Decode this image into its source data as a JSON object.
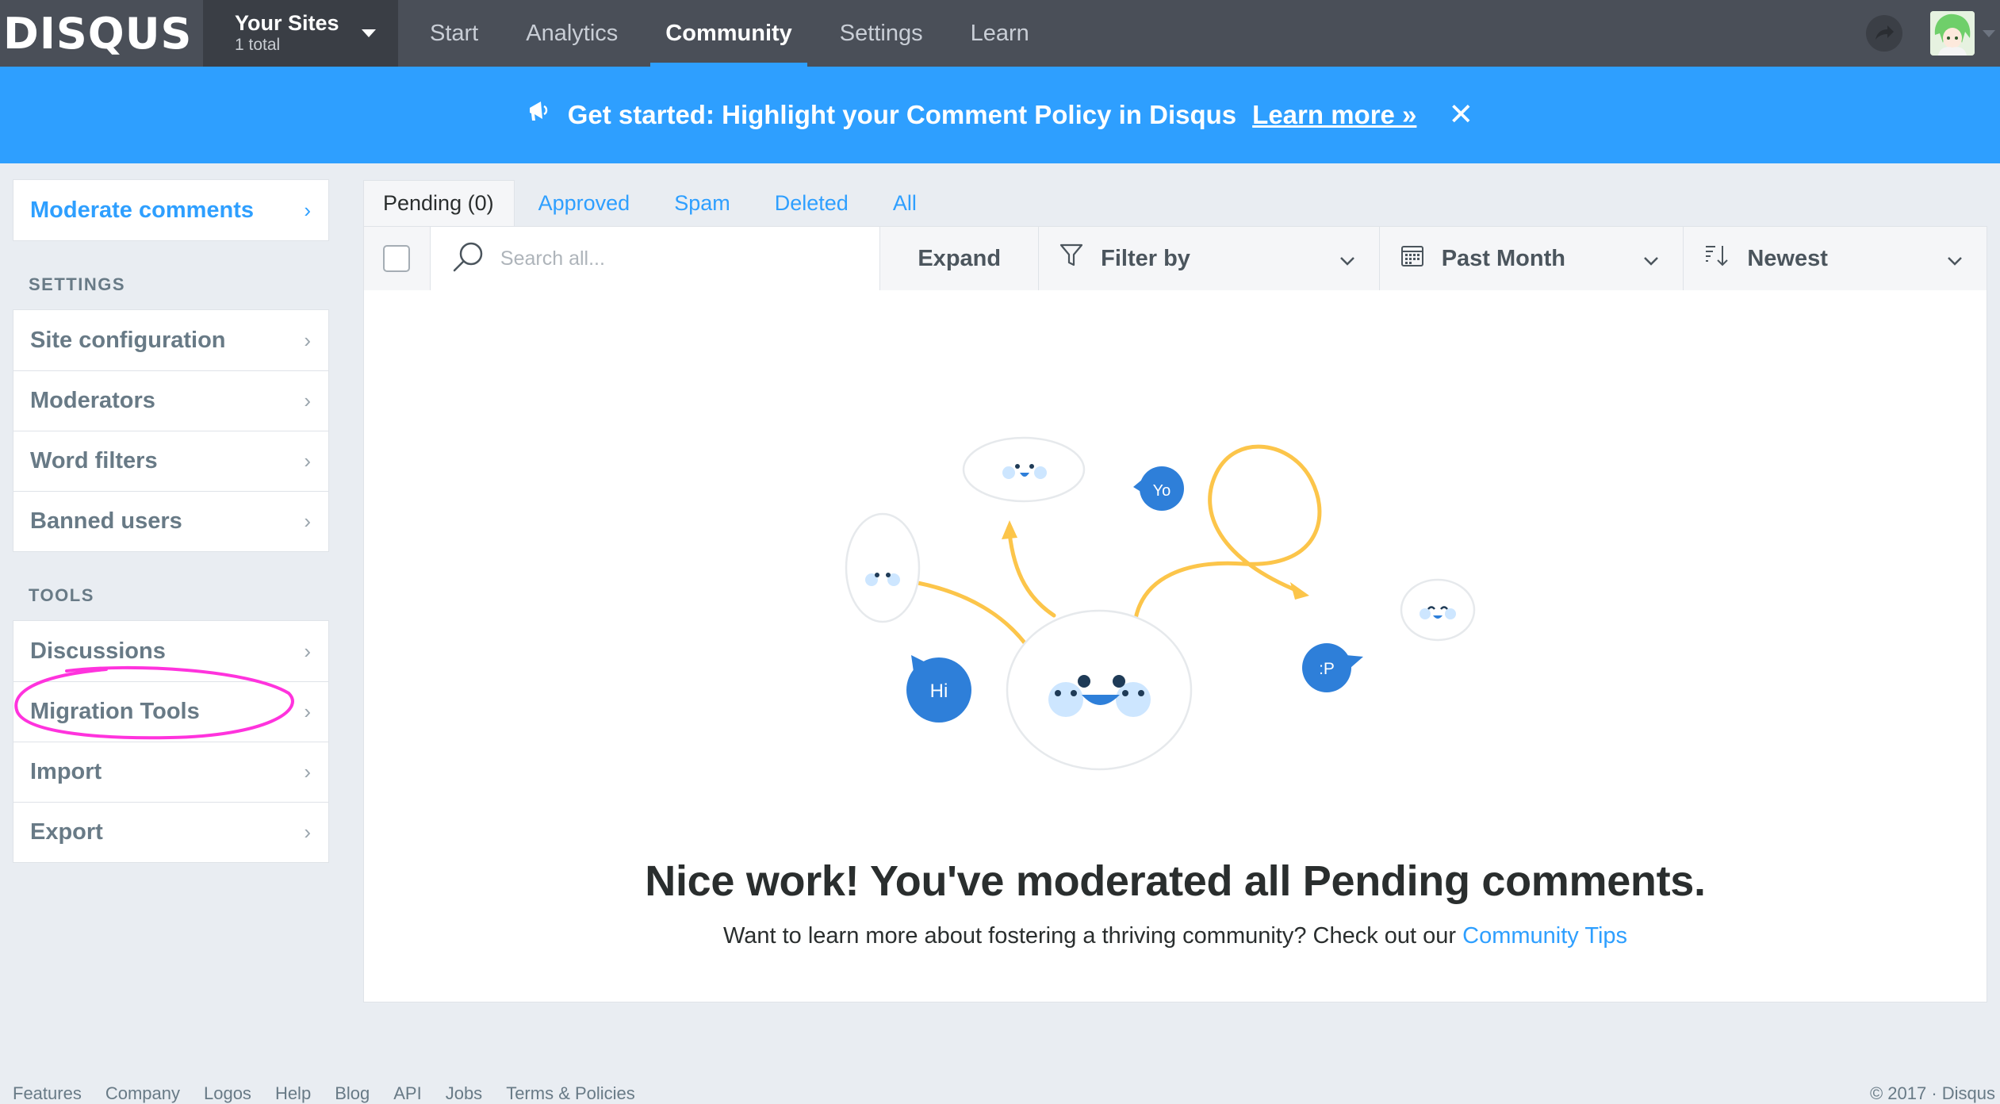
{
  "nav": {
    "logo": "DISQUS",
    "site_switcher": {
      "title": "Your Sites",
      "subtitle": "1 total"
    },
    "tabs": [
      {
        "label": "Start",
        "active": false
      },
      {
        "label": "Analytics",
        "active": false
      },
      {
        "label": "Community",
        "active": true
      },
      {
        "label": "Settings",
        "active": false
      },
      {
        "label": "Learn",
        "active": false
      }
    ]
  },
  "banner": {
    "text": "Get started: Highlight your Comment Policy in Disqus",
    "link": "Learn more »",
    "close": "✕"
  },
  "sidebar": {
    "primary": "Moderate comments",
    "settings_heading": "SETTINGS",
    "settings_items": [
      "Site configuration",
      "Moderators",
      "Word filters",
      "Banned users"
    ],
    "tools_heading": "TOOLS",
    "tools_items": [
      "Discussions",
      "Migration Tools",
      "Import",
      "Export"
    ]
  },
  "tabs": [
    {
      "label": "Pending (0)",
      "active": true
    },
    {
      "label": "Approved",
      "active": false
    },
    {
      "label": "Spam",
      "active": false
    },
    {
      "label": "Deleted",
      "active": false
    },
    {
      "label": "All",
      "active": false
    }
  ],
  "toolbar": {
    "search_placeholder": "Search all...",
    "expand": "Expand",
    "filter": "Filter by",
    "date": "Past Month",
    "sort": "Newest"
  },
  "empty_state": {
    "title": "Nice work! You've moderated all Pending comments.",
    "subtitle": "Want to learn more about fostering a thriving community? Check out our",
    "link": "Community Tips",
    "bubbles": [
      "Yo",
      "Hi",
      ":P"
    ]
  },
  "footer": {
    "links": [
      "Features",
      "Company",
      "Logos",
      "Help",
      "Blog",
      "API",
      "Jobs",
      "Terms & Policies"
    ],
    "copyright": "© 2017 · Disqus"
  },
  "colors": {
    "nav_bg": "#4a4f58",
    "accent": "#2e9fff",
    "banner_bg": "#2e9fff",
    "illustration_yellow": "#fcc54a",
    "annotation": "#ff33dd"
  },
  "icons": [
    "megaphone-icon",
    "close-icon",
    "chevron-right-icon",
    "search-icon",
    "filter-icon",
    "calendar-icon",
    "sort-icon",
    "chevron-down-icon",
    "notification-icon"
  ]
}
